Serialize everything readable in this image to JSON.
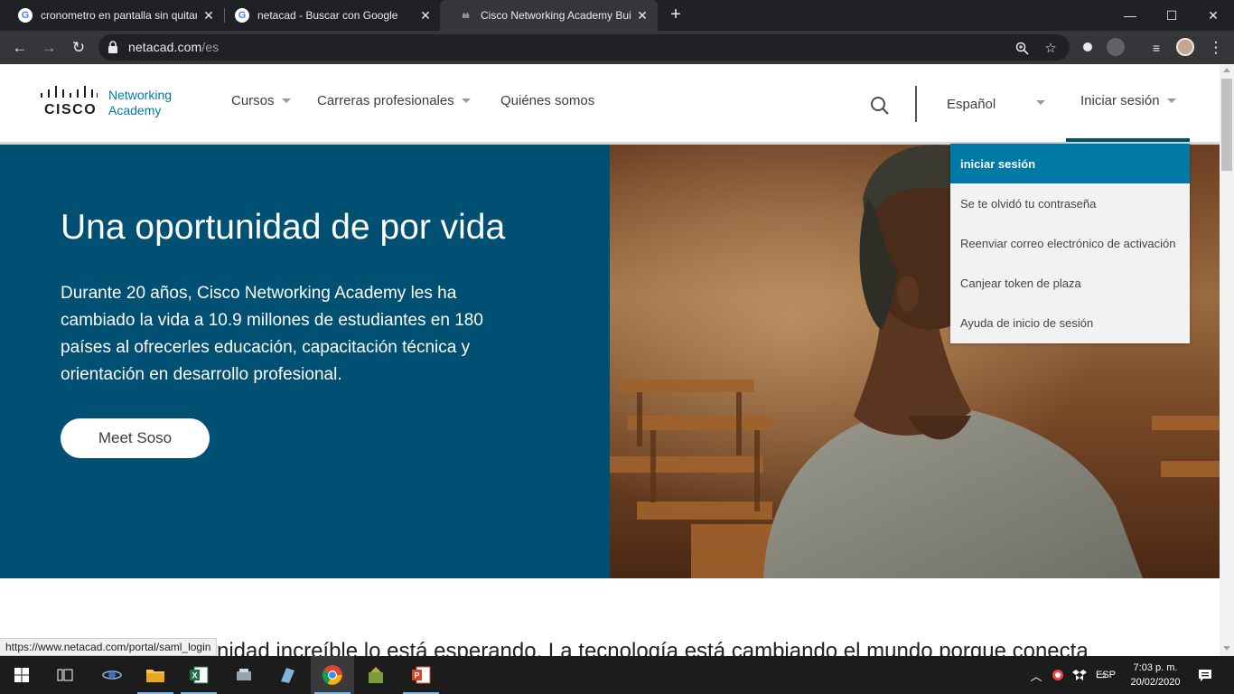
{
  "browser": {
    "tabs": [
      {
        "title": "cronometro en pantalla sin quitar",
        "favicon": "google-icon"
      },
      {
        "title": "netacad - Buscar con Google",
        "favicon": "google-icon"
      },
      {
        "title": "Cisco Networking Academy Builds",
        "favicon": "cisco-icon",
        "active": true
      }
    ],
    "new_tab": "+",
    "url_host": "netacad.com",
    "url_path": "/es",
    "window_controls": {
      "minimize": "—",
      "maximize": "☐",
      "close": "✕"
    }
  },
  "site": {
    "logo": {
      "brand": "CISCO",
      "line1": "Networking",
      "line2": "Academy"
    },
    "nav": [
      {
        "label": "Cursos",
        "has_caret": true
      },
      {
        "label": "Carreras profesionales",
        "has_caret": true
      },
      {
        "label": "Quiénes somos",
        "has_caret": false
      }
    ],
    "language": "Español",
    "login_label": "Iniciar sesión",
    "login_menu": [
      {
        "label": "iniciar sesión",
        "active": true
      },
      {
        "label": "Se te olvidó tu contraseña"
      },
      {
        "label": "Reenviar correo electrónico de activación"
      },
      {
        "label": "Canjear token de plaza"
      },
      {
        "label": "Ayuda de inicio de sesión"
      }
    ],
    "hero": {
      "title": "Una oportunidad de por vida",
      "body": "Durante 20 años, Cisco Networking Academy les ha cambiado la vida a 10.9 millones de estudiantes en 180 países al ofrecerles educación, capacitación técnica y orientación en desarrollo profesional.",
      "button": "Meet Soso"
    },
    "below_text": "nidad increíble lo está esperando. La tecnología está cambiando el mundo porque conecta"
  },
  "status_url": "https://www.netacad.com/portal/saml_login",
  "taskbar": {
    "tray_lang": "ESP",
    "time": "7:03 p. m.",
    "date": "20/02/2020"
  },
  "colors": {
    "hero_blue": "#005073",
    "menu_active": "#0079a6",
    "cisco_blue": "#0077b4"
  }
}
